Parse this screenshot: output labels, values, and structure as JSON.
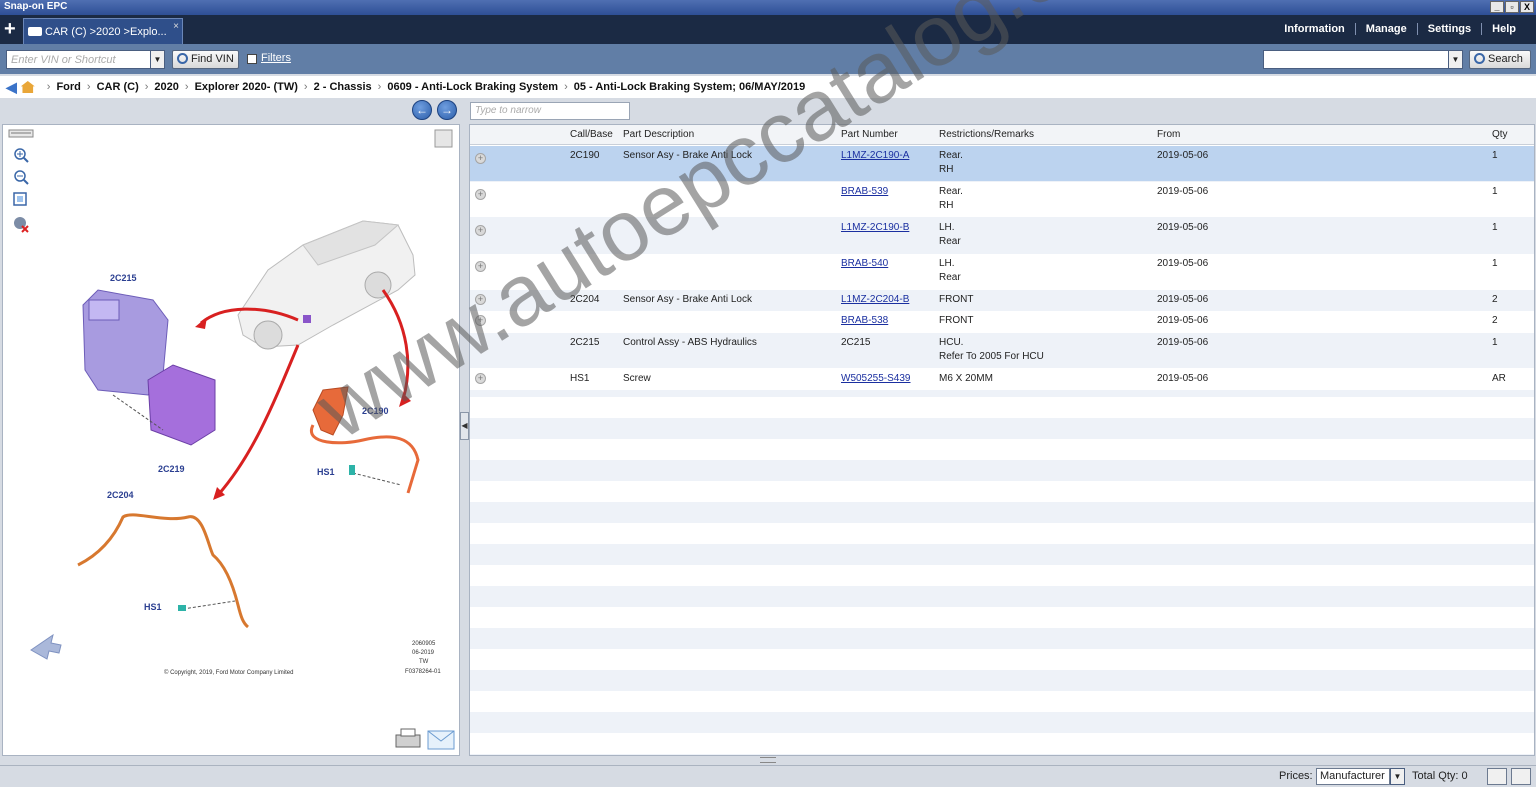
{
  "window": {
    "title": "Snap-on EPC",
    "controls": [
      "_",
      "▫",
      "X"
    ]
  },
  "tabs": {
    "add": "+",
    "active_label": "CAR (C) >2020 >Explo...",
    "close": "×"
  },
  "menu": [
    "Information",
    "Manage",
    "Settings",
    "Help"
  ],
  "toolbar": {
    "vin_placeholder": "Enter VIN or Shortcut",
    "find_vin": "Find VIN",
    "filters": "Filters",
    "search": "Search"
  },
  "breadcrumb": [
    "Ford",
    "CAR (C)",
    "2020",
    "Explorer 2020- (TW)",
    "2 - Chassis",
    "0609 - Anti-Lock Braking System",
    "05 - Anti-Lock Braking System; 06/MAY/2019"
  ],
  "narrow_placeholder": "Type to narrow",
  "columns": {
    "call_base": "Call/Base",
    "description": "Part Description",
    "part_number": "Part Number",
    "remarks": "Restrictions/Remarks",
    "from": "From",
    "qty": "Qty"
  },
  "parts": [
    {
      "call": "2C190",
      "desc": "Sensor Asy - Brake Anti Lock",
      "pn": "L1MZ-2C190-A",
      "r1": "Rear.",
      "r2": "RH",
      "from": "2019-05-06",
      "qty": "1"
    },
    {
      "call": "",
      "desc": "",
      "pn": "BRAB-539",
      "r1": "Rear.",
      "r2": "RH",
      "from": "2019-05-06",
      "qty": "1"
    },
    {
      "call": "",
      "desc": "",
      "pn": "L1MZ-2C190-B",
      "r1": "LH.",
      "r2": "Rear",
      "from": "2019-05-06",
      "qty": "1"
    },
    {
      "call": "",
      "desc": "",
      "pn": "BRAB-540",
      "r1": "LH.",
      "r2": "Rear",
      "from": "2019-05-06",
      "qty": "1"
    },
    {
      "call": "2C204",
      "desc": "Sensor Asy - Brake Anti Lock",
      "pn": "L1MZ-2C204-B",
      "r1": "FRONT",
      "r2": "",
      "from": "2019-05-06",
      "qty": "2"
    },
    {
      "call": "",
      "desc": "",
      "pn": "BRAB-538",
      "r1": "FRONT",
      "r2": "",
      "from": "2019-05-06",
      "qty": "2"
    },
    {
      "call": "2C215",
      "desc": "Control Assy - ABS Hydraulics",
      "pn": "2C215",
      "r1": "HCU.",
      "r2": "Refer To 2005 For HCU",
      "from": "2019-05-06",
      "qty": "1"
    },
    {
      "call": "HS1",
      "desc": "Screw",
      "pn": "W505255-S439",
      "r1": "M6 X 20MM",
      "r2": "",
      "from": "2019-05-06",
      "qty": "AR"
    }
  ],
  "diagram": {
    "callouts": [
      "2C215",
      "2C190",
      "2C219",
      "HS1",
      "2C204",
      "HS1"
    ],
    "copyright": "© Copyright, 2019, Ford Motor Company Limited",
    "ref": [
      "2060905",
      "06-2019",
      "TW",
      "F0378264-01"
    ]
  },
  "status": {
    "prices_label": "Prices:",
    "prices_value": "Manufacturer",
    "total_qty": "Total Qty: 0"
  },
  "watermark": "www.autoepccatalog.com"
}
